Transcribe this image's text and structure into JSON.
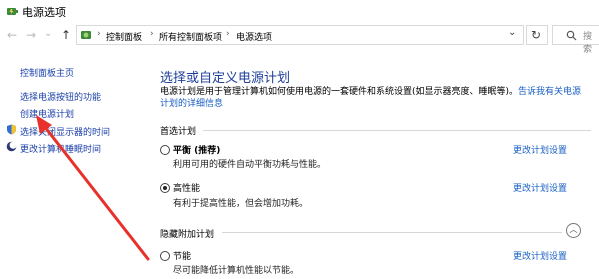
{
  "window": {
    "title": "电源选项"
  },
  "nav": {
    "back_glyph": "←",
    "forward_glyph": "→",
    "recent_glyph": "⌄",
    "up_glyph": "↑",
    "breadcrumbs": [
      "控制面板",
      "所有控制面板项",
      "电源选项"
    ],
    "separator": "›",
    "dropdown_glyph": "⌄",
    "refresh_glyph": "↻",
    "search_placeholder": "搜索"
  },
  "sidebar": {
    "items": [
      {
        "label": "控制面板主页"
      },
      {
        "label": "选择电源按钮的功能"
      },
      {
        "label": "创建电源计划"
      },
      {
        "label": "选择关闭显示器的时间"
      },
      {
        "label": "更改计算机睡眠时间"
      }
    ]
  },
  "main": {
    "heading": "选择或自定义电源计划",
    "description": "电源计划是用于管理计算机如何使用电源的一套硬件和系统设置(如显示器亮度、睡眠等)。",
    "description_link": "告诉我有关电源计划的详细信息",
    "preferred_title": "首选计划",
    "hidden_title": "隐藏附加计划",
    "collapse_glyph": "︿",
    "plans": [
      {
        "name": "平衡",
        "suffix": " (推荐)",
        "desc": "利用可用的硬件自动平衡功耗与性能。",
        "link": "更改计划设置",
        "selected": false
      },
      {
        "name": "高性能",
        "suffix": "",
        "desc": "有利于提高性能，但会增加功耗。",
        "link": "更改计划设置",
        "selected": true
      },
      {
        "name": "节能",
        "suffix": "",
        "desc": "尽可能降低计算机性能以节能。",
        "link": "更改计划设置",
        "selected": false
      }
    ]
  },
  "colors": {
    "link": "#1a5fc4",
    "heading": "#1e3f9a",
    "annotation_arrow": "#e8312a"
  },
  "icons": {
    "app": "power-options-icon",
    "shield": "shield-icon",
    "moon": "moon-icon"
  }
}
